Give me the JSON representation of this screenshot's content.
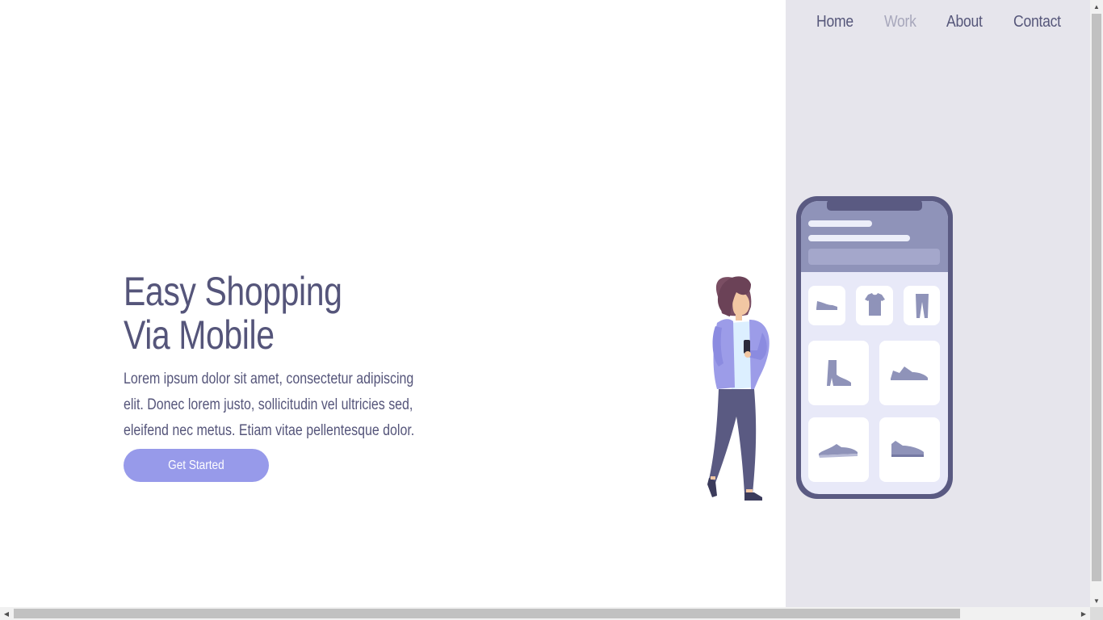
{
  "nav": {
    "items": [
      {
        "label": "Home",
        "active": false
      },
      {
        "label": "Work",
        "active": true
      },
      {
        "label": "About",
        "active": false
      },
      {
        "label": "Contact",
        "active": false
      }
    ]
  },
  "hero": {
    "title_line1": "Easy Shopping",
    "title_line2": "Via Mobile",
    "description": "Lorem ipsum dolor sit amet, consectetur adipiscing elit. Donec lorem justo, sollicitudin vel ultricies sed, eleifend nec metus. Etiam vitae pellentesque dolor.",
    "cta_label": "Get Started"
  },
  "colors": {
    "accent": "#979aea",
    "text": "#55557a",
    "panel": "#e6e5ec",
    "nav_active": "#a7a7bb",
    "phone_frame": "#5a5a82"
  },
  "illustration": {
    "phone_products": [
      "shoe-icon",
      "tshirt-icon",
      "pants-icon",
      "boot-icon",
      "sneaker-icon",
      "sneaker-icon",
      "sneaker-icon"
    ]
  }
}
